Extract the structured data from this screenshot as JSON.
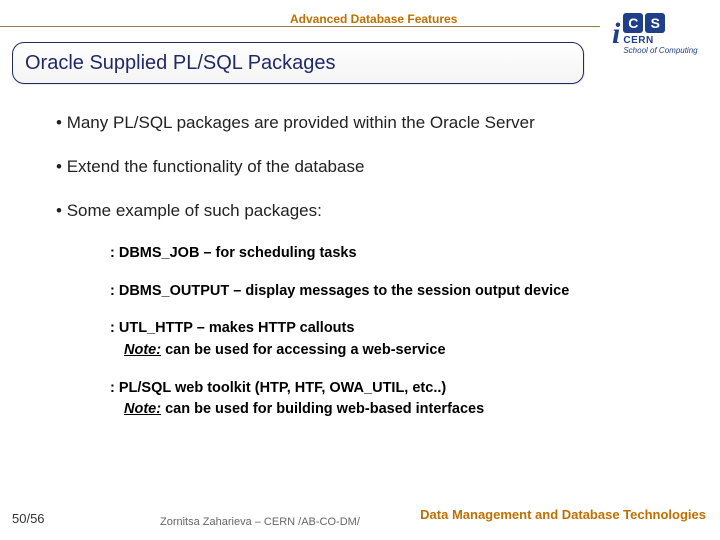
{
  "header": {
    "course": "Advanced Database Features",
    "logo": {
      "cern": "CERN",
      "school": "School of Computing"
    }
  },
  "title": "Oracle Supplied PL/SQL Packages",
  "bullets": [
    "Many PL/SQL packages are provided within the Oracle Server",
    "Extend the functionality of the database",
    "Some example of such packages:"
  ],
  "subs": [
    {
      "pkg": "DBMS_JOB",
      "desc": " – for scheduling tasks"
    },
    {
      "pkg": "DBMS_OUTPUT",
      "desc": " – display messages to the session output device"
    },
    {
      "pkg": "UTL_HTTP",
      "desc": " – makes HTTP callouts",
      "note_label": "Note:",
      "note": "  can be used for accessing a web-service"
    },
    {
      "pkg": "PL/SQL web toolkit (HTP, HTF, OWA_UTIL, etc..)",
      "desc": "",
      "note_label": "Note:",
      "note": " can be used for building web-based interfaces"
    }
  ],
  "footer": {
    "page": "50/56",
    "center": "Zornitsa Zaharieva – CERN /AB-CO-DM/",
    "right": "Data Management and Database Technologies"
  }
}
